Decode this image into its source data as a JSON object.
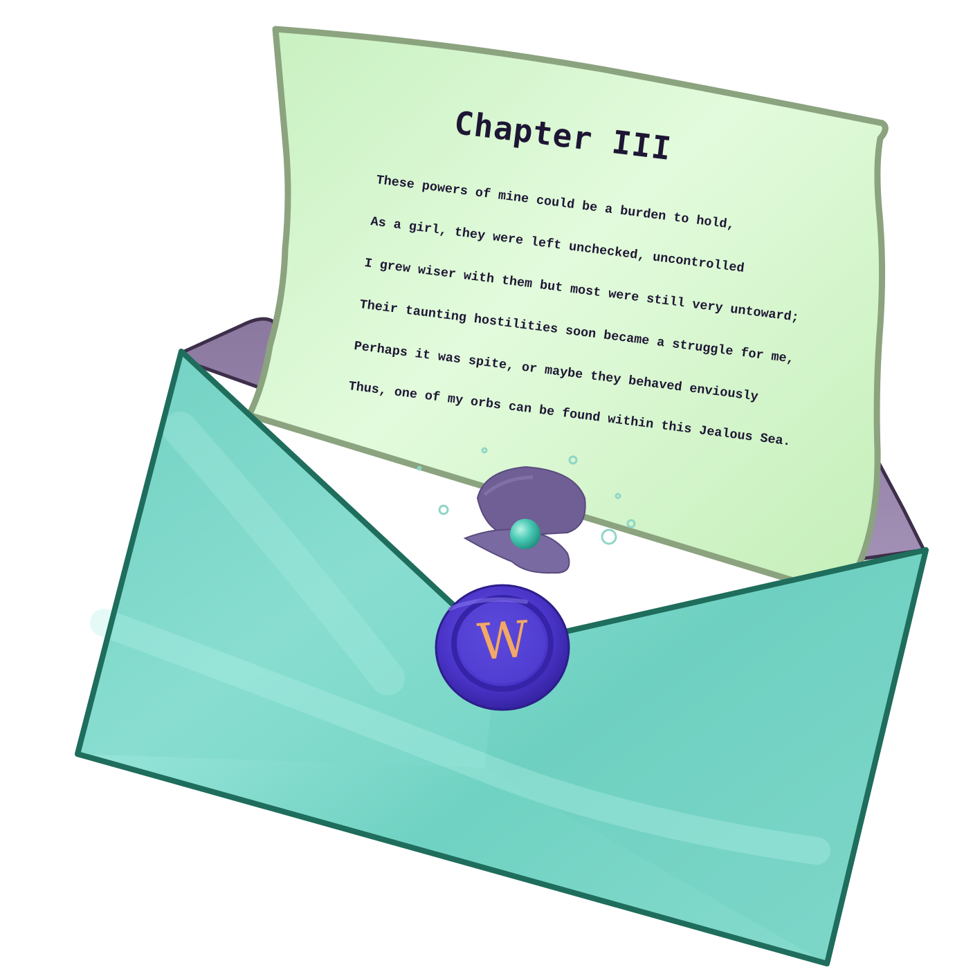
{
  "letter": {
    "title": "Chapter III",
    "lines": [
      "These powers of mine could be a burden to hold,",
      "As a girl, they were left unchecked, uncontrolled",
      "I grew wiser with them but most were still very untoward;",
      "Their taunting hostilities soon became a struggle for me,",
      "Perhaps it was spite, or maybe they behaved enviously",
      "Thus, one of my orbs can be found within this Jealous Sea."
    ]
  },
  "seal": {
    "letter": "W"
  },
  "colors": {
    "envelope": "#7fd9cc",
    "envelope_edge": "#1f6d5c",
    "envelope_inside": "#8d7a9e",
    "paper": "#d8f7d2",
    "paper_edge": "#8ba37f",
    "seal": "#4c36c9",
    "seal_letter": "#f2a86a",
    "shell": "#6f5f95",
    "pearl": "#49c9b4",
    "text": "#1e1634"
  },
  "icons": [
    "envelope-icon",
    "paper-letter-icon",
    "clam-shell-icon",
    "pearl-icon",
    "wax-seal-icon",
    "bubble-icon"
  ]
}
